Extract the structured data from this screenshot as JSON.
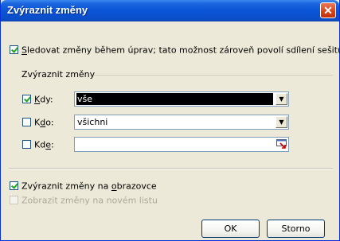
{
  "window": {
    "title": "Zvýraznit změny"
  },
  "track_changes": {
    "checked": true,
    "label_pre": "",
    "label_accel": "S",
    "label_post": "ledovat změny během úprav; tato možnost zároveň povolí sdílení sešitu"
  },
  "group": {
    "label": "Zvýraznit změny"
  },
  "when": {
    "checked": true,
    "label_accel": "K",
    "label_post": "dy:",
    "value": "vše"
  },
  "who": {
    "checked": false,
    "label_pre": "K",
    "label_accel": "d",
    "label_post": "o:",
    "value": "všichni"
  },
  "where": {
    "checked": false,
    "label_pre": "Kd",
    "label_accel": "e",
    "label_post": ":",
    "value": ""
  },
  "highlight_on_screen": {
    "checked": true,
    "label_pre": "Zvýraznit změny na ",
    "label_accel": "o",
    "label_post": "brazovce"
  },
  "list_on_new_sheet": {
    "checked": false,
    "enabled": false,
    "label": "Zobrazit změny na novém listu"
  },
  "buttons": {
    "ok": "OK",
    "cancel": "Storno"
  },
  "icons": {
    "close": "close-icon",
    "dropdown": "chevron-down-icon",
    "range_picker": "range-picker-icon"
  }
}
